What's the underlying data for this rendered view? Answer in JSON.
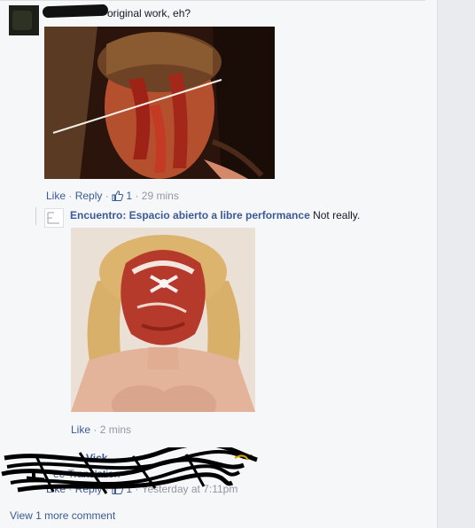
{
  "comment1": {
    "text": "original work, eh?",
    "like_label": "Like",
    "reply_label": "Reply",
    "likes": "1",
    "time": "29 mins"
  },
  "reply": {
    "author": "Encuentro: Espacio abierto a libre performance",
    "text": "Not really.",
    "like_label": "Like",
    "time": "2 mins"
  },
  "comment3": {
    "author_fragment": "Vick",
    "translation_fragment": "ee Translation",
    "like_label": "Like",
    "reply_label": "Reply",
    "likes": "1",
    "time": "Yesterday at 7:11pm"
  },
  "view_more": "View 1 more comment",
  "colors": {
    "link": "#3b5998",
    "meta": "#9197a3",
    "background": "#f6f7f9"
  },
  "icons": [
    "thumbs-up-icon"
  ]
}
